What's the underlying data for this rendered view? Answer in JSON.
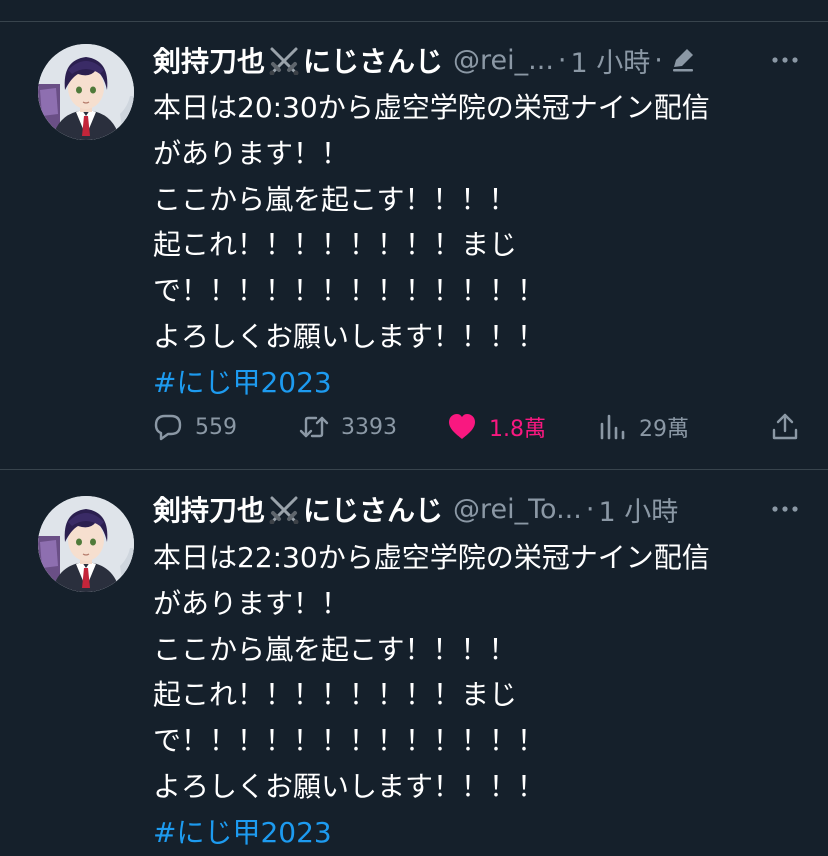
{
  "tweets": [
    {
      "author": {
        "name_part1": "剣持刀也",
        "name_part2": "にじさんじ",
        "handle": "@rei_...",
        "time": "1 小時"
      },
      "text_lines": [
        "本日は20:30から虚空学院の栄冠ナイン配信",
        "があります！！",
        "ここから嵐を起こす！！！！",
        "起これ！！！！！！！！まじ",
        "で！！！！！！！！！！！！！",
        "よろしくお願いします！！！！"
      ],
      "hashtag": "#にじ甲2023",
      "stats": {
        "replies": "559",
        "retweets": "3393",
        "likes": "1.8萬",
        "views": "29萬"
      },
      "edited": true
    },
    {
      "author": {
        "name_part1": "剣持刀也",
        "name_part2": "にじさんじ",
        "handle": "@rei_To...",
        "time": "1 小時"
      },
      "text_lines": [
        "本日は22:30から虚空学院の栄冠ナイン配信",
        "があります！！",
        "ここから嵐を起こす！！！！",
        "起これ！！！！！！！！まじ",
        "で！！！！！！！！！！！！！",
        "よろしくお願いします！！！！"
      ],
      "hashtag": "#にじ甲2023",
      "edited": false
    }
  ],
  "separator": "·",
  "icons": {
    "name_emoji": "crossed-swords-icon",
    "edited": "pencil-icon",
    "more": "more-horizontal-icon",
    "reply": "speech-bubble-icon",
    "retweet": "retweet-icon",
    "like": "heart-icon",
    "views": "bar-chart-icon",
    "share": "share-upload-icon"
  },
  "colors": {
    "background": "#15202b",
    "text": "#ffffff",
    "secondary_text": "#8b98a5",
    "link": "#1d9bf0",
    "like_active": "#f91880",
    "divider": "#38444d"
  }
}
